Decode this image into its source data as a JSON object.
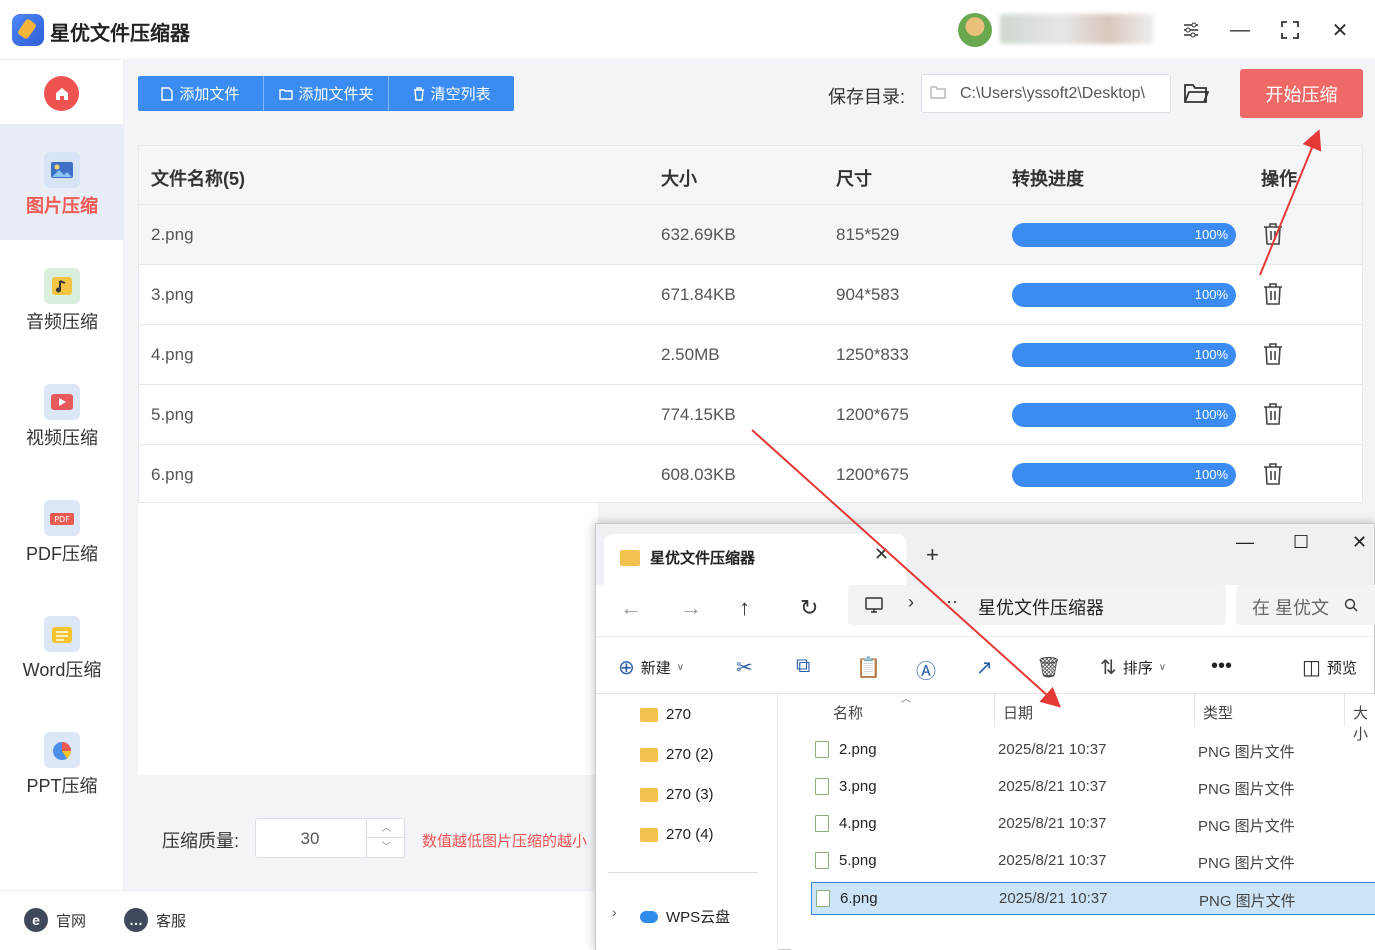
{
  "app": {
    "title": "星优文件压缩器"
  },
  "sidebar": {
    "items": [
      {
        "label": "图片压缩",
        "icon": "image-icon"
      },
      {
        "label": "音频压缩",
        "icon": "music-icon"
      },
      {
        "label": "视频压缩",
        "icon": "video-icon"
      },
      {
        "label": "PDF压缩",
        "icon": "pdf-icon"
      },
      {
        "label": "Word压缩",
        "icon": "word-icon"
      },
      {
        "label": "PPT压缩",
        "icon": "ppt-icon"
      }
    ]
  },
  "toolbar": {
    "add_file": "添加文件",
    "add_folder": "添加文件夹",
    "clear_list": "清空列表"
  },
  "save": {
    "label": "保存目录:",
    "path": "C:\\Users\\yssoft2\\Desktop\\"
  },
  "start_button": "开始压缩",
  "table": {
    "headers": [
      "文件名称(5)",
      "大小",
      "尺寸",
      "转换进度",
      "操作"
    ],
    "rows": [
      {
        "name": "2.png",
        "size": "632.69KB",
        "dims": "815*529",
        "progress": "100%"
      },
      {
        "name": "3.png",
        "size": "671.84KB",
        "dims": "904*583",
        "progress": "100%"
      },
      {
        "name": "4.png",
        "size": "2.50MB",
        "dims": "1250*833",
        "progress": "100%"
      },
      {
        "name": "5.png",
        "size": "774.15KB",
        "dims": "1200*675",
        "progress": "100%"
      },
      {
        "name": "6.png",
        "size": "608.03KB",
        "dims": "1200*675",
        "progress": "100%"
      }
    ]
  },
  "quality": {
    "label": "压缩质量:",
    "value": "30",
    "hint": "数值越低图片压缩的越小"
  },
  "footer": {
    "website": "官网",
    "support": "客服"
  },
  "explorer": {
    "tab_title": "星优文件压缩器",
    "address": "星优文件压缩器",
    "search_placeholder": "在 星优文",
    "cmd": {
      "new": "新建",
      "sort": "排序",
      "preview": "预览"
    },
    "tree": [
      "270",
      "270 (2)",
      "270 (3)",
      "270 (4)",
      "WPS云盘"
    ],
    "columns": [
      "名称",
      "日期",
      "类型",
      "大小"
    ],
    "files": [
      {
        "name": "2.png",
        "date": "2025/8/21 10:37",
        "type": "PNG 图片文件"
      },
      {
        "name": "3.png",
        "date": "2025/8/21 10:37",
        "type": "PNG 图片文件"
      },
      {
        "name": "4.png",
        "date": "2025/8/21 10:37",
        "type": "PNG 图片文件"
      },
      {
        "name": "5.png",
        "date": "2025/8/21 10:37",
        "type": "PNG 图片文件"
      },
      {
        "name": "6.png",
        "date": "2025/8/21 10:37",
        "type": "PNG 图片文件"
      }
    ]
  },
  "colors": {
    "accent": "#3b8cf2",
    "danger": "#ef5350",
    "start": "#ef6a66",
    "annotation": "#e53935"
  }
}
